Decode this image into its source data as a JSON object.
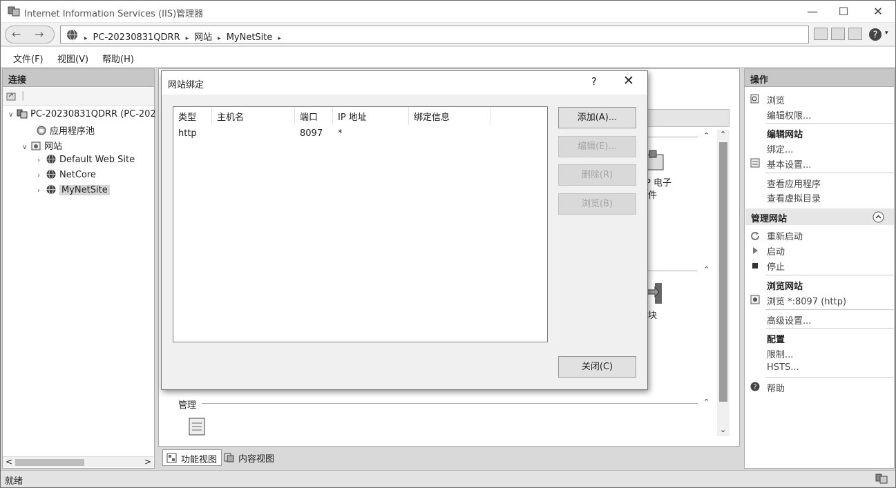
{
  "window": {
    "title": "Internet Information Services (IIS)管理器",
    "minimize_glyph": "—",
    "maximize_glyph": "☐",
    "close_glyph": "✕"
  },
  "address": {
    "back_glyph": "←",
    "forward_glyph": "→",
    "crumbs": [
      "PC-20230831QDRR",
      "网站",
      "MyNetSite"
    ],
    "separator": "▸"
  },
  "menu": [
    "文件(F)",
    "视图(V)",
    "帮助(H)"
  ],
  "connections": {
    "title": "连接",
    "tree": {
      "server": "PC-20230831QDRR (PC-202",
      "app_pools": "应用程序池",
      "sites": "网站",
      "site_items": [
        "Default Web Site",
        "NetCore",
        "MyNetSite"
      ]
    },
    "hscroll_left": "<",
    "hscroll_right": ">"
  },
  "middle": {
    "fragment_top1": "P 电子",
    "fragment_top2": "件",
    "fragment_mid": "块",
    "section_manage": "管理",
    "view_tabs": [
      "功能视图",
      "内容视图"
    ]
  },
  "actions": {
    "title": "操作",
    "items": {
      "browse": "浏览",
      "edit_perms": "编辑权限...",
      "edit_site_head": "编辑网站",
      "bindings": "绑定...",
      "basic_settings": "基本设置...",
      "view_apps": "查看应用程序",
      "view_vdirs": "查看虚拟目录",
      "manage_site_head": "管理网站",
      "restart": "重新启动",
      "start": "启动",
      "stop": "停止",
      "browse_site_head": "浏览网站",
      "browse_8097": "浏览 *:8097 (http)",
      "advanced": "高级设置...",
      "config_head": "配置",
      "limits": "限制...",
      "hsts": "HSTS...",
      "help": "帮助"
    },
    "collapse_glyph": "⌃"
  },
  "status": {
    "text": "就绪"
  },
  "dialog": {
    "title": "网站绑定",
    "help_glyph": "?",
    "close_glyph": "✕",
    "columns": [
      "类型",
      "主机名",
      "端口",
      "IP 地址",
      "绑定信息"
    ],
    "rows": [
      {
        "type": "http",
        "host": "",
        "port": "8097",
        "ip": "*",
        "info": ""
      }
    ],
    "buttons": {
      "add": "添加(A)...",
      "edit": "编辑(E)...",
      "remove": "删除(R)",
      "browse": "浏览(B)",
      "close": "关闭(C)"
    }
  }
}
